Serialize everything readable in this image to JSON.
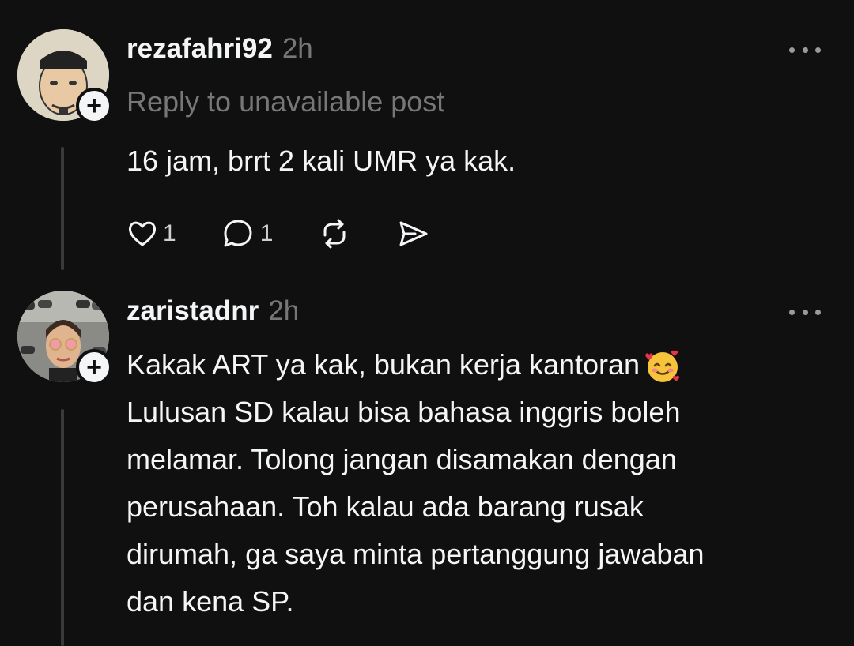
{
  "posts": [
    {
      "username": "rezafahri92",
      "time": "2h",
      "reply_context": "Reply to unavailable post",
      "text_lines": [
        "16 jam, brrt 2 kali UMR ya kak."
      ],
      "likes": "1",
      "replies": "1",
      "icons": [
        "heart-icon",
        "comment-icon",
        "repost-icon",
        "share-icon",
        "more-icon"
      ]
    },
    {
      "username": "zaristadnr",
      "time": "2h",
      "text_lines": [
        "Kakak ART ya kak, bukan kerja kantoran",
        "Lulusan SD kalau bisa bahasa inggris boleh",
        "melamar. Tolong jangan disamakan dengan",
        "perusahaan. Toh kalau ada barang rusak",
        "dirumah, ga saya minta pertanggung jawaban",
        "dan kena SP."
      ],
      "emoji": "smiling-face-with-hearts",
      "icons": [
        "more-icon"
      ]
    }
  ],
  "colors": {
    "background": "#101010",
    "primary_text": "#f3f5f7",
    "secondary_text": "#777777",
    "thread_line": "#3a3a3a"
  }
}
